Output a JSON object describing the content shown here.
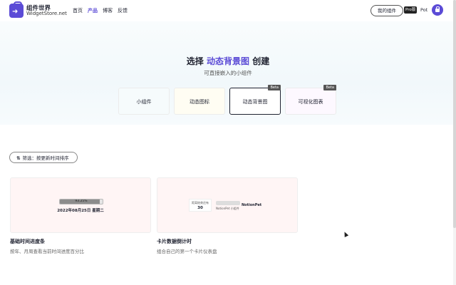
{
  "header": {
    "brand_name": "组件世界",
    "brand_sub": "WidgetStore.net",
    "nav": [
      "首页",
      "产品",
      "博客",
      "反馈"
    ],
    "active_nav": "产品",
    "my_widgets": "我的组件",
    "pro_badge": "Pro版",
    "user": "Pot"
  },
  "hero": {
    "title_prefix": "选择",
    "title_highlight": "动态背景图",
    "title_suffix": "创建",
    "subtitle": "可直接嵌入的小组件",
    "accent_color": "#5b4bd6"
  },
  "categories": [
    {
      "label": "小组件",
      "badge": ""
    },
    {
      "label": "动态图标",
      "badge": ""
    },
    {
      "label": "动态背景图",
      "badge": "Beta"
    },
    {
      "label": "可视化图表",
      "badge": "Beta"
    }
  ],
  "selected_category": "动态背景图",
  "filter": {
    "icon": "⇅",
    "label": "筛选：按更新时间排序"
  },
  "tiles": [
    {
      "title": "基础时间进度条",
      "desc": "按年、月周查看当前时间进度百分比",
      "preview": {
        "percent_label": "93.25%",
        "progress": 0.9325,
        "date": "2022年08月25日 星期二"
      }
    },
    {
      "title": "卡片数据倒计时",
      "desc": "组合自己的第一个卡片仪表盘",
      "preview": {
        "box_label": "距离结束还有",
        "number": "30",
        "sub_label": "NotionPet 小组件",
        "name": "NotionPet"
      }
    }
  ]
}
